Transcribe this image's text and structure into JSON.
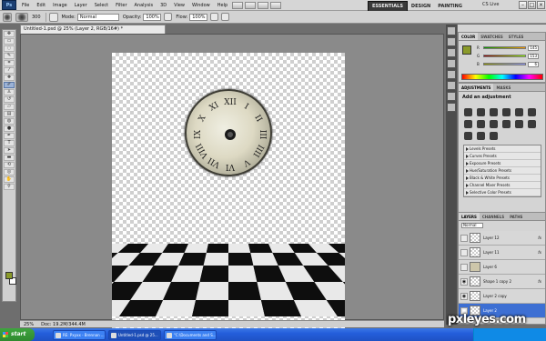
{
  "menubar": {
    "logo": "Ps",
    "items": [
      "File",
      "Edit",
      "Image",
      "Layer",
      "Select",
      "Filter",
      "Analysis",
      "3D",
      "View",
      "Window",
      "Help"
    ],
    "workspaces": [
      "ESSENTIALS",
      "DESIGN",
      "PAINTING"
    ],
    "cslive": "CS Live"
  },
  "options": {
    "brush_size": "300",
    "mode_label": "Mode:",
    "mode_value": "Normal",
    "opacity_label": "Opacity:",
    "opacity_value": "100%",
    "flow_label": "Flow:",
    "flow_value": "100%"
  },
  "document": {
    "tab_title": "Untitled-1.psd @ 25% (Layer 2, RGB/16#) *"
  },
  "status": {
    "zoom": "25%",
    "doc_size": "Doc: 19.2M/344.4M"
  },
  "color_panel": {
    "tabs": [
      "COLOR",
      "SWATCHES",
      "STYLES"
    ],
    "r_label": "R",
    "g_label": "G",
    "b_label": "B",
    "r": "145",
    "g": "153",
    "b": "6",
    "fg_color": "#8a9a2a"
  },
  "adjustments": {
    "tabs": [
      "ADJUSTMENTS",
      "MASKS"
    ],
    "title": "Add an adjustment",
    "presets": [
      "Levels Presets",
      "Curves Presets",
      "Exposure Presets",
      "Hue/Saturation Presets",
      "Black & White Presets",
      "Channel Mixer Presets",
      "Selective Color Presets"
    ]
  },
  "layers": {
    "tabs": [
      "LAYERS",
      "CHANNELS",
      "PATHS"
    ],
    "blend_mode": "Normal",
    "items": [
      {
        "name": "Layer 12",
        "fx": "fx"
      },
      {
        "name": "Layer 11",
        "fx": "fx"
      },
      {
        "name": "Layer 6",
        "fx": ""
      },
      {
        "name": "Shape 1 copy 2",
        "fx": "fx"
      },
      {
        "name": "Layer 2 copy",
        "fx": ""
      },
      {
        "name": "Layer 2",
        "fx": ""
      }
    ]
  },
  "taskbar": {
    "start": "start",
    "tasks": [
      "RE: Pxyxx - Brennan ...",
      "Untitled-1.psd @ 25...",
      "\"C:\\Documents and S..."
    ]
  },
  "watermark": "pxleyes.com",
  "clock": {
    "numerals": [
      "XII",
      "I",
      "II",
      "III",
      "IIII",
      "V",
      "VI",
      "VII",
      "VIII",
      "IX",
      "X",
      "XI"
    ]
  }
}
